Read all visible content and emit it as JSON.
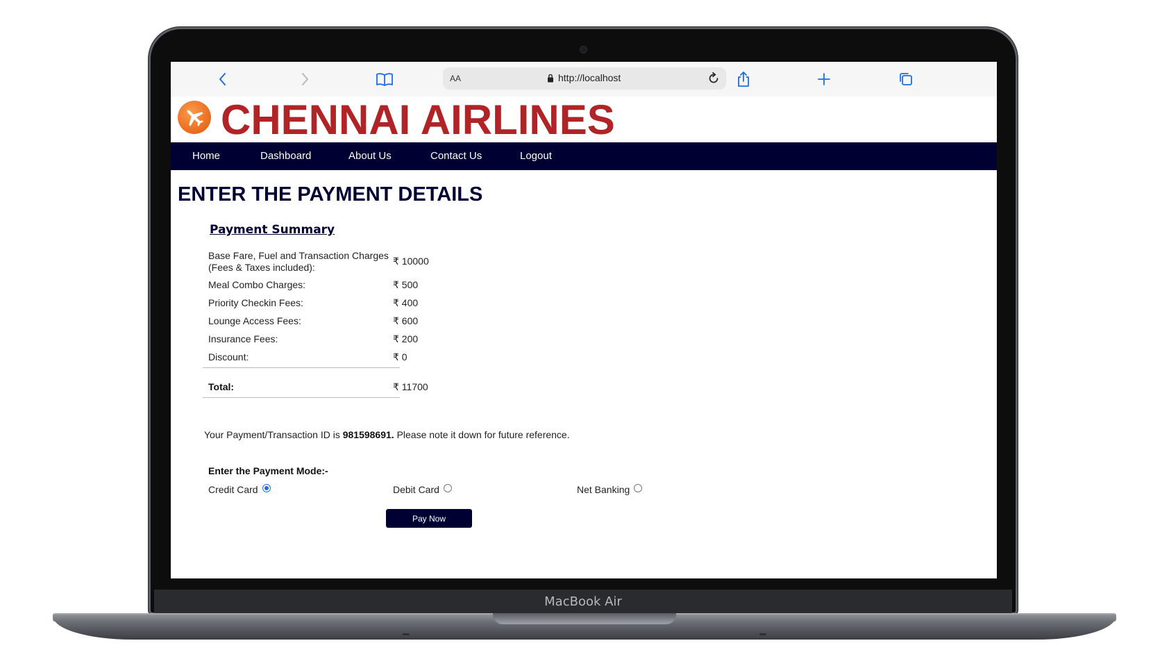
{
  "device": {
    "model_label": "MacBook Air"
  },
  "browser": {
    "text_size_label": "AA",
    "url": "http://localhost"
  },
  "site": {
    "brand": "CHENNAI AIRLINES",
    "nav": [
      "Home",
      "Dashboard",
      "About Us",
      "Contact Us",
      "Logout"
    ]
  },
  "page": {
    "title": "ENTER THE PAYMENT DETAILS",
    "summary_title": "Payment Summary",
    "currency_symbol": "₹",
    "rows": [
      {
        "label": "Base Fare, Fuel and Transaction Charges (Fees & Taxes included):",
        "value": "₹ 10000"
      },
      {
        "label": "Meal Combo Charges:",
        "value": "₹ 500"
      },
      {
        "label": "Priority Checkin Fees:",
        "value": "₹ 400"
      },
      {
        "label": "Lounge Access Fees:",
        "value": "₹ 600"
      },
      {
        "label": "Insurance Fees:",
        "value": "₹ 200"
      },
      {
        "label": "Discount:",
        "value": "₹ 0"
      }
    ],
    "total_label": "Total:",
    "total_value": "₹ 11700",
    "txn_prefix": "Your Payment/Transaction ID is ",
    "txn_id": "981598691.",
    "txn_suffix": " Please note it down for future reference.",
    "mode_title": "Enter the Payment Mode:-",
    "modes": [
      {
        "label": "Credit Card",
        "selected": true
      },
      {
        "label": "Debit Card",
        "selected": false
      },
      {
        "label": "Net Banking",
        "selected": false
      }
    ],
    "pay_button": "Pay Now"
  },
  "colors": {
    "brand_red": "#b02327",
    "navy": "#000033",
    "logo_orange": "#ea6a1d",
    "safari_blue": "#1a6ee6"
  }
}
